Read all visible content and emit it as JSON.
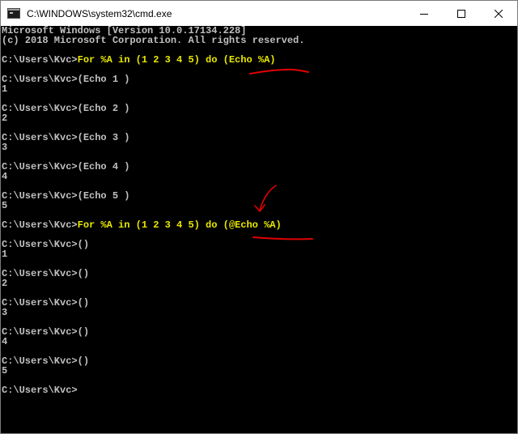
{
  "window": {
    "title": "C:\\WINDOWS\\system32\\cmd.exe",
    "icon": "console-app-icon",
    "controls": {
      "minimize": "minimize-icon",
      "maximize": "maximize-icon",
      "close": "close-icon"
    }
  },
  "console": {
    "colors": {
      "background": "#000000",
      "text": "#c0c0c0",
      "command": "#e8e800",
      "annotation": "#e00000"
    },
    "lines": [
      {
        "prompt": "Microsoft Windows [Version 10.0.17134.228]",
        "cmd": ""
      },
      {
        "prompt": "(c) 2018 Microsoft Corporation. All rights reserved.",
        "cmd": ""
      },
      {
        "prompt": "",
        "cmd": ""
      },
      {
        "prompt": "C:\\Users\\Kvc>",
        "cmd": "For %A in (1 2 3 4 5) do (Echo %A)"
      },
      {
        "prompt": "",
        "cmd": ""
      },
      {
        "prompt": "C:\\Users\\Kvc>(Echo 1 )",
        "cmd": ""
      },
      {
        "prompt": "1",
        "cmd": ""
      },
      {
        "prompt": "",
        "cmd": ""
      },
      {
        "prompt": "C:\\Users\\Kvc>(Echo 2 )",
        "cmd": ""
      },
      {
        "prompt": "2",
        "cmd": ""
      },
      {
        "prompt": "",
        "cmd": ""
      },
      {
        "prompt": "C:\\Users\\Kvc>(Echo 3 )",
        "cmd": ""
      },
      {
        "prompt": "3",
        "cmd": ""
      },
      {
        "prompt": "",
        "cmd": ""
      },
      {
        "prompt": "C:\\Users\\Kvc>(Echo 4 )",
        "cmd": ""
      },
      {
        "prompt": "4",
        "cmd": ""
      },
      {
        "prompt": "",
        "cmd": ""
      },
      {
        "prompt": "C:\\Users\\Kvc>(Echo 5 )",
        "cmd": ""
      },
      {
        "prompt": "5",
        "cmd": ""
      },
      {
        "prompt": "",
        "cmd": ""
      },
      {
        "prompt": "C:\\Users\\Kvc>",
        "cmd": "For %A in (1 2 3 4 5) do (@Echo %A)"
      },
      {
        "prompt": "",
        "cmd": ""
      },
      {
        "prompt": "C:\\Users\\Kvc>()",
        "cmd": ""
      },
      {
        "prompt": "1",
        "cmd": ""
      },
      {
        "prompt": "",
        "cmd": ""
      },
      {
        "prompt": "C:\\Users\\Kvc>()",
        "cmd": ""
      },
      {
        "prompt": "2",
        "cmd": ""
      },
      {
        "prompt": "",
        "cmd": ""
      },
      {
        "prompt": "C:\\Users\\Kvc>()",
        "cmd": ""
      },
      {
        "prompt": "3",
        "cmd": ""
      },
      {
        "prompt": "",
        "cmd": ""
      },
      {
        "prompt": "C:\\Users\\Kvc>()",
        "cmd": ""
      },
      {
        "prompt": "4",
        "cmd": ""
      },
      {
        "prompt": "",
        "cmd": ""
      },
      {
        "prompt": "C:\\Users\\Kvc>()",
        "cmd": ""
      },
      {
        "prompt": "5",
        "cmd": ""
      },
      {
        "prompt": "",
        "cmd": ""
      },
      {
        "prompt": "C:\\Users\\Kvc>",
        "cmd": ""
      }
    ]
  }
}
